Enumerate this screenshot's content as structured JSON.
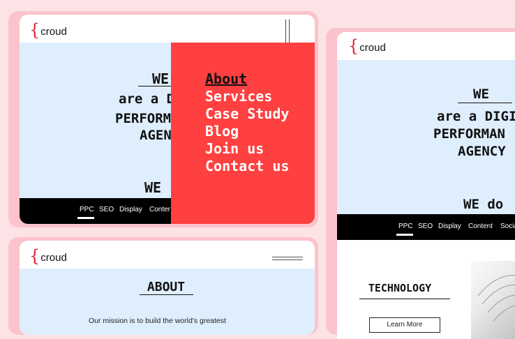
{
  "brand": {
    "logo_mark": "{",
    "logo_text": "croud"
  },
  "screen1": {
    "headline_1": "WE",
    "headline_2": "are a DI",
    "headline_3": "PERFORM",
    "headline_4": "AGEN",
    "subhead": "WE",
    "nav": [
      "PPC",
      "SEO",
      "Display",
      "Conter"
    ],
    "menu": [
      "About",
      "Services",
      "Case Study",
      "Blog",
      "Join us",
      "Contact us"
    ]
  },
  "screen2": {
    "section_title": "ABOUT",
    "mission_text": "Our mission is to build the world's greatest"
  },
  "screen3": {
    "headline_1": "WE",
    "headline_2": "are a DIGIT",
    "headline_3": "PERFORMAN",
    "headline_4": "AGENCY",
    "subhead": "WE do",
    "nav": [
      "PPC",
      "SEO",
      "Display",
      "Content",
      "Socia"
    ],
    "section_title": "TECHNOLOGY",
    "cta_label": "Learn More"
  },
  "colors": {
    "overlay": "#ff4040",
    "hero": "#dfeefd",
    "frame": "#fbc3cb",
    "logo_accent": "#e2202f"
  }
}
